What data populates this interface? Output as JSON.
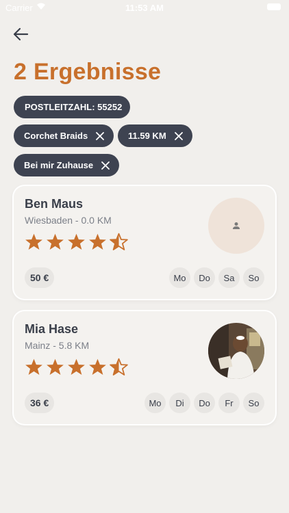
{
  "status_bar": {
    "carrier": "Carrier",
    "time": "11:53 AM"
  },
  "title": "2 Ergebnisse",
  "filters": {
    "postcode": "POSTLEITZAHL: 55252",
    "chips": [
      "Corchet Braids",
      "11.59 KM",
      "Bei mir Zuhause"
    ]
  },
  "results": [
    {
      "name": "Ben Maus",
      "location": "Wiesbaden - 0.0 KM",
      "rating": 4.5,
      "price": "50 €",
      "avatar": "placeholder-person-icon",
      "days": [
        "Mo",
        "Do",
        "Sa",
        "So"
      ]
    },
    {
      "name": "Mia Hase",
      "location": "Mainz - 5.8 KM",
      "rating": 4.5,
      "price": "36 €",
      "avatar": "photo",
      "days": [
        "Mo",
        "Di",
        "Do",
        "Fr",
        "So"
      ]
    }
  ],
  "colors": {
    "accent": "#c8702c",
    "chip_bg": "#3e4351",
    "background": "#f1efec"
  }
}
